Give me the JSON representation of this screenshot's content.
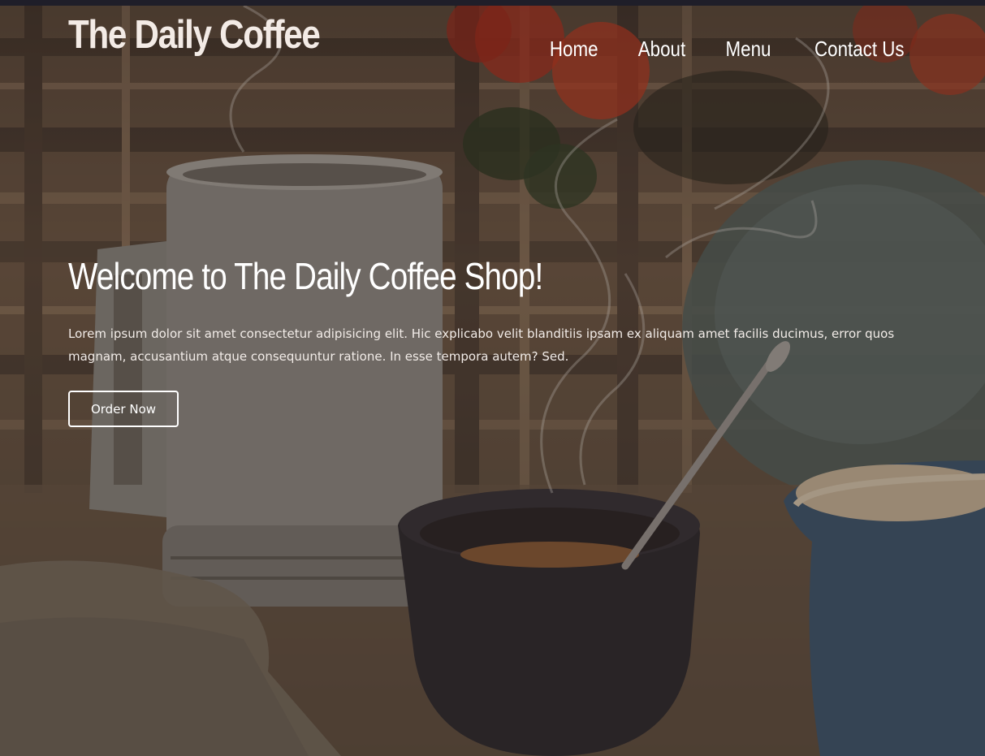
{
  "header": {
    "brand": "The Daily Coffee",
    "nav": [
      "Home",
      "About",
      "Menu",
      "Contact Us"
    ]
  },
  "hero": {
    "title": "Welcome to The Daily Coffee Shop!",
    "text": "Lorem ipsum dolor sit amet consectetur adipisicing elit. Hic explicabo velit blanditiis ipsam ex aliquam amet facilis ducimus, error quos magnam, accusantium atque consequuntur ratione. In esse tempora autem? Sed.",
    "button_label": "Order Now"
  },
  "colors": {
    "topbar": "#1f1e29",
    "text": "#ffffff"
  }
}
